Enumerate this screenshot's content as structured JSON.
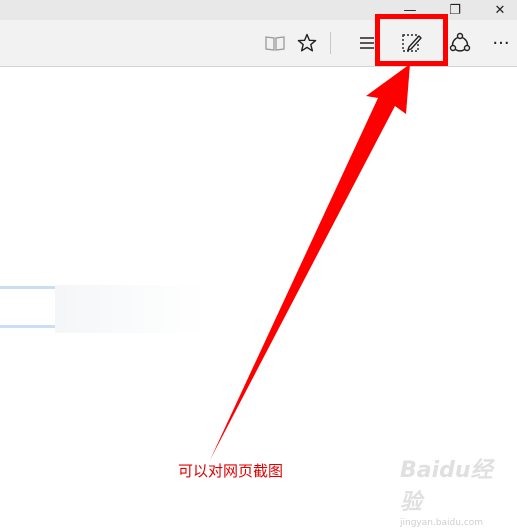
{
  "window": {
    "controls": [
      {
        "name": "minimize",
        "glyph": "—"
      },
      {
        "name": "restore",
        "glyph": "❐"
      },
      {
        "name": "close",
        "glyph": "✕"
      }
    ]
  },
  "toolbar": {
    "icons": [
      "reading-view-icon",
      "favorite-star-icon",
      "hub-icon",
      "web-note-icon",
      "share-icon",
      "more-icon"
    ],
    "more_label": "···"
  },
  "annotation": {
    "text": "可以对网页截图",
    "color": "#ff0000"
  },
  "watermark": {
    "logo": "Baidu经验",
    "url": "jingyan.baidu.com"
  },
  "colors": {
    "highlight": "#ff0000",
    "toolbar_bg": "#f2f2f2",
    "titlebar_bg": "#e8e8e8"
  }
}
